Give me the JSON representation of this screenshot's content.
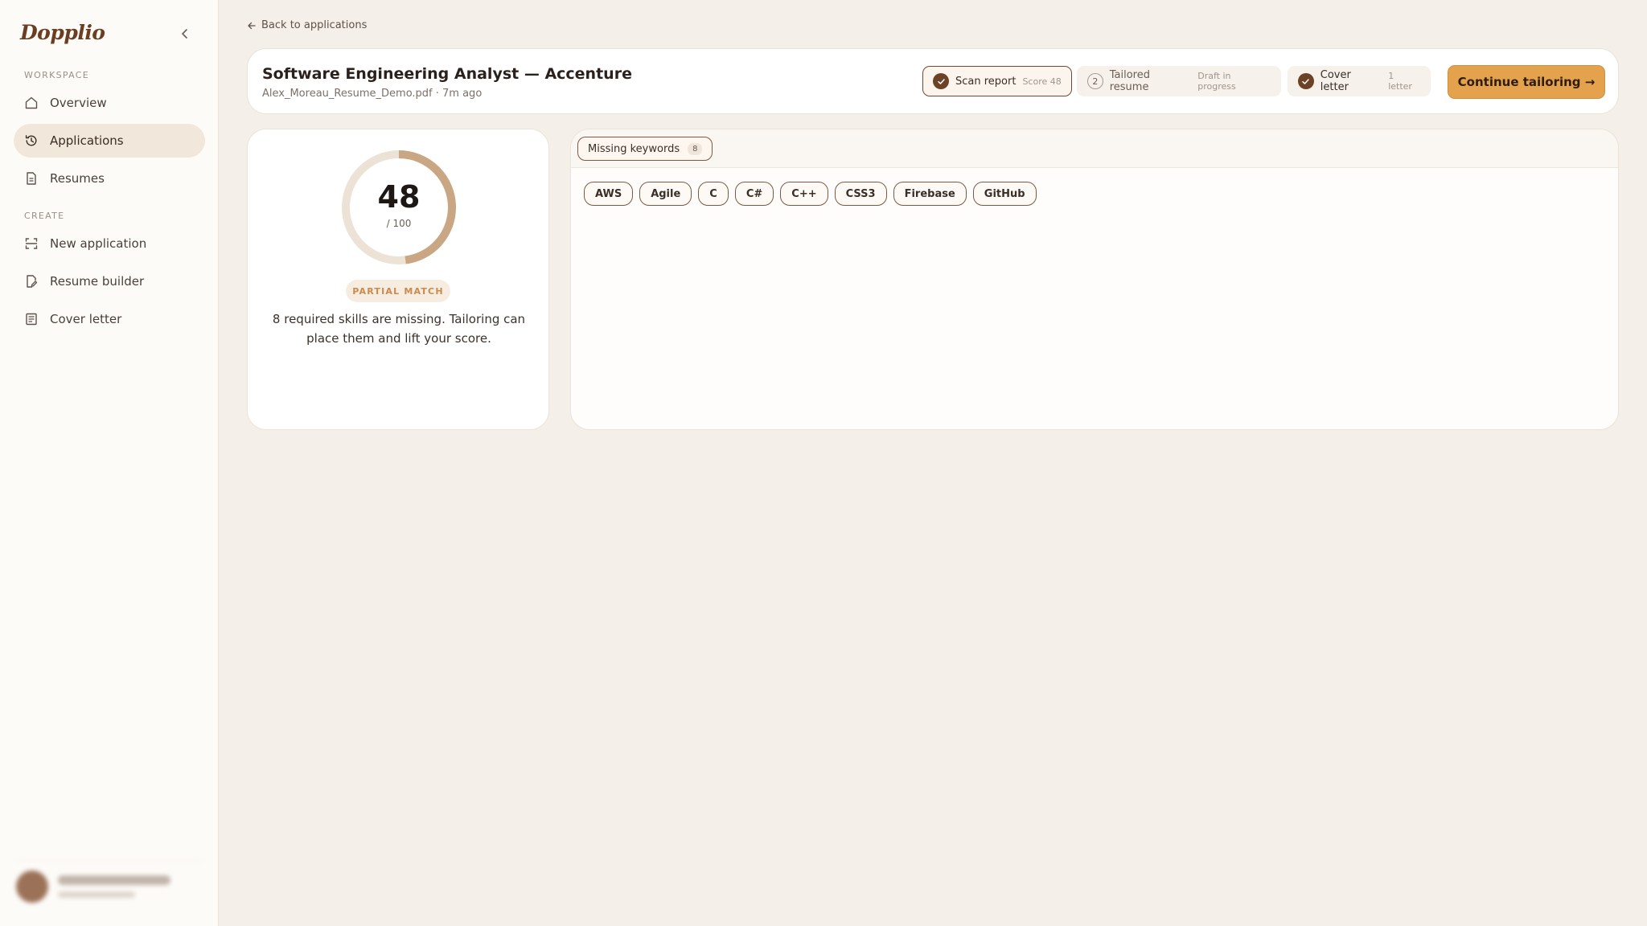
{
  "app": {
    "logo": "Dopplio"
  },
  "sidebar": {
    "workspace_label": "WORKSPACE",
    "create_label": "CREATE",
    "workspace_items": [
      {
        "label": "Overview",
        "icon": "home-icon"
      },
      {
        "label": "Applications",
        "icon": "history-icon",
        "active": true
      },
      {
        "label": "Resumes",
        "icon": "document-icon"
      }
    ],
    "create_items": [
      {
        "label": "New application",
        "icon": "scan-icon"
      },
      {
        "label": "Resume builder",
        "icon": "edit-document-icon"
      },
      {
        "label": "Cover letter",
        "icon": "letter-icon"
      }
    ]
  },
  "back_link": "Back to applications",
  "header": {
    "title": "Software Engineering Analyst — Accenture",
    "meta": "Alex_Moreau_Resume_Demo.pdf · 7m ago",
    "steps": [
      {
        "label": "Scan report",
        "sub": "Score 48",
        "state": "done",
        "current": true
      },
      {
        "label": "Tailored resume",
        "sub": "Draft in progress",
        "state": "pending",
        "number": "2"
      },
      {
        "label": "Cover letter",
        "sub": "1 letter",
        "state": "done"
      }
    ],
    "continue_label": "Continue tailoring →"
  },
  "score": {
    "value": "48",
    "denominator": "/ 100",
    "fraction": 0.48,
    "badge": "PARTIAL MATCH",
    "description": "8 required skills are missing. Tailoring can place them and lift your score."
  },
  "keywords": {
    "tab_label": "Missing keywords",
    "count": "8",
    "chips": [
      "AWS",
      "Agile",
      "C",
      "C#",
      "C++",
      "CSS3",
      "Firebase",
      "GitHub"
    ]
  },
  "colors": {
    "accent": "#e3a24b",
    "brand": "#6b3e22",
    "gauge_fill": "#c9a684",
    "gauge_track": "#ede2d6",
    "background": "#f4efe8"
  }
}
